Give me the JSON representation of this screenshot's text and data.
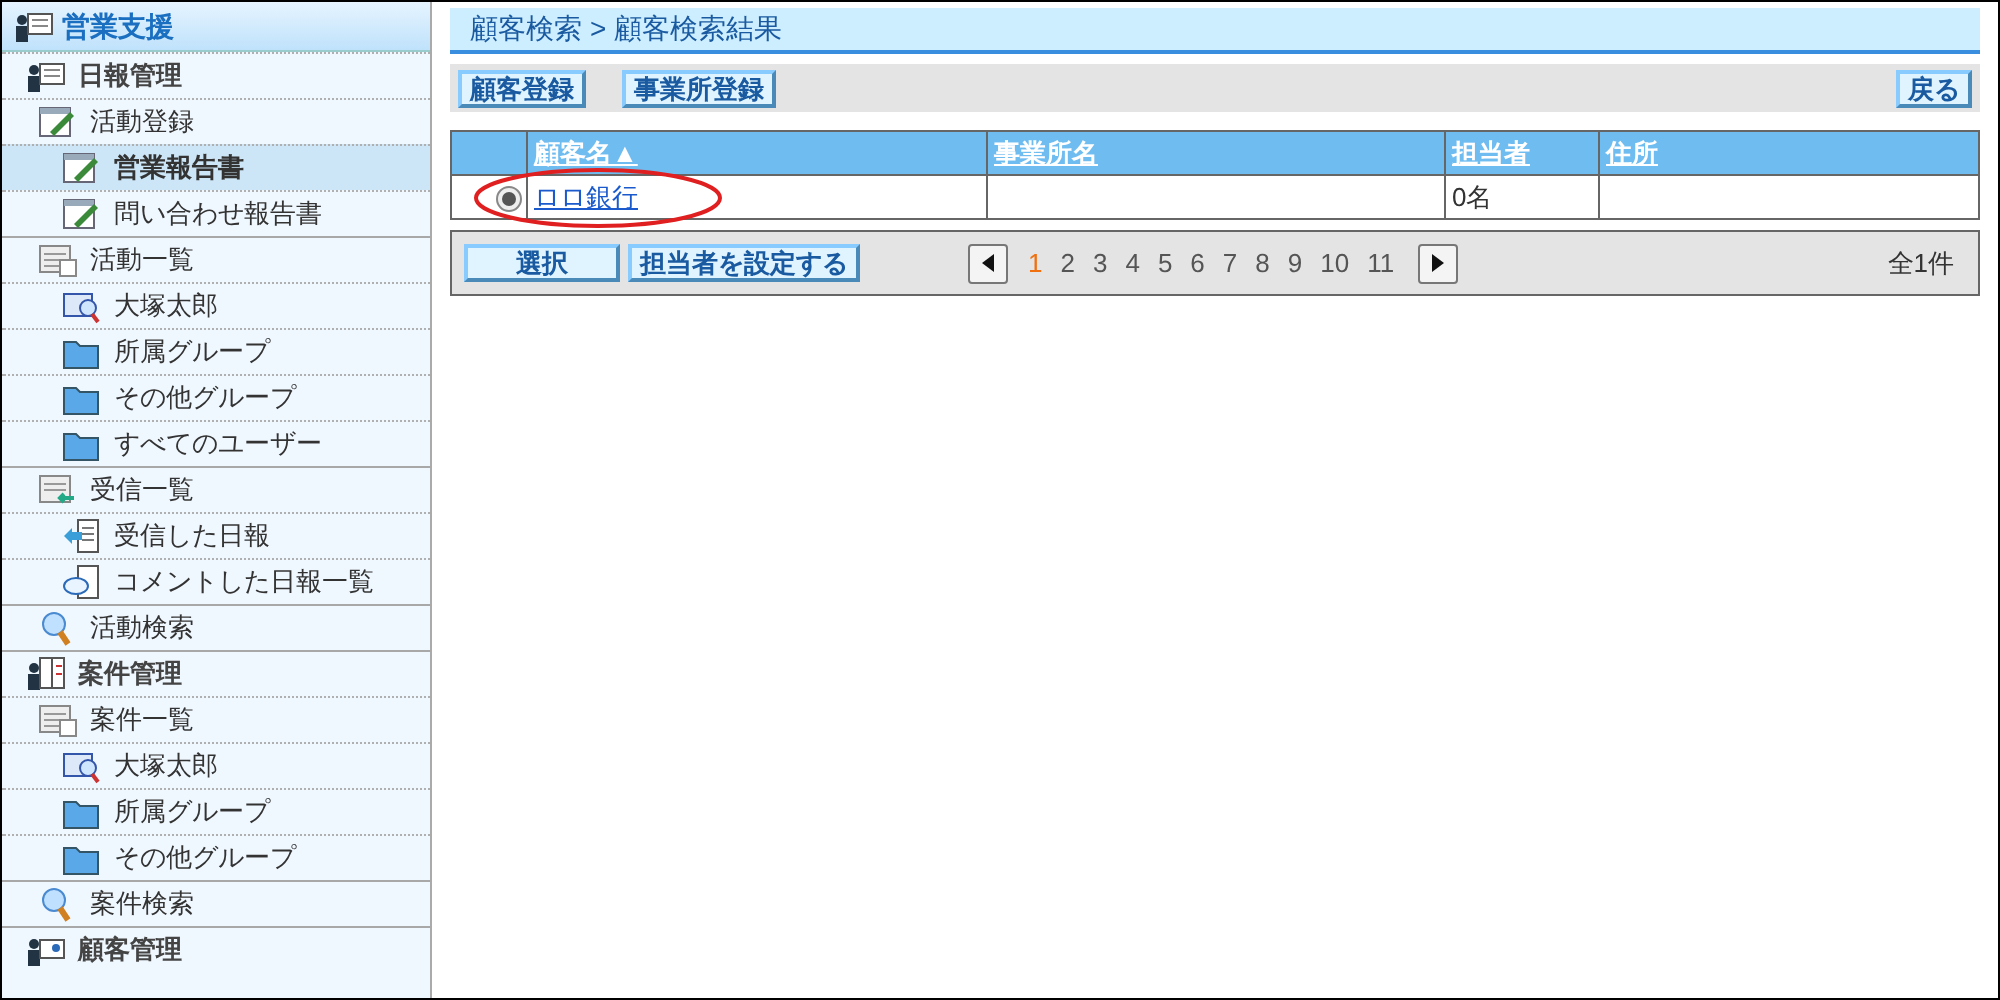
{
  "sidebar": {
    "title": "営業支援",
    "sections": [
      {
        "label": "日報管理",
        "kind": "report",
        "children": [
          {
            "label": "活動登録",
            "kind": "form",
            "selected": false,
            "children": [
              {
                "label": "営業報告書",
                "kind": "form",
                "selected": true
              },
              {
                "label": "問い合わせ報告書",
                "kind": "form",
                "selected": false
              }
            ]
          },
          {
            "label": "活動一覧",
            "kind": "list",
            "selected": false,
            "children": [
              {
                "label": "大塚太郎",
                "kind": "person",
                "selected": false
              },
              {
                "label": "所属グループ",
                "kind": "folder",
                "selected": false
              },
              {
                "label": "その他グループ",
                "kind": "folder",
                "selected": false
              },
              {
                "label": "すべてのユーザー",
                "kind": "folder",
                "selected": false
              }
            ]
          },
          {
            "label": "受信一覧",
            "kind": "inbox",
            "selected": false,
            "children": [
              {
                "label": "受信した日報",
                "kind": "received",
                "selected": false
              },
              {
                "label": "コメントした日報一覧",
                "kind": "comment",
                "selected": false
              }
            ]
          },
          {
            "label": "活動検索",
            "kind": "search",
            "selected": false
          }
        ]
      },
      {
        "label": "案件管理",
        "kind": "project",
        "children": [
          {
            "label": "案件一覧",
            "kind": "list",
            "selected": false,
            "children": [
              {
                "label": "大塚太郎",
                "kind": "person",
                "selected": false
              },
              {
                "label": "所属グループ",
                "kind": "folder",
                "selected": false
              },
              {
                "label": "その他グループ",
                "kind": "folder",
                "selected": false
              }
            ]
          },
          {
            "label": "案件検索",
            "kind": "search",
            "selected": false
          }
        ]
      },
      {
        "label": "顧客管理",
        "kind": "customer"
      }
    ]
  },
  "breadcrumb": [
    "顧客検索",
    "顧客検索結果"
  ],
  "breadcrumb_separator": ">",
  "toolbar": {
    "left_buttons": [
      "顧客登録",
      "事業所登録"
    ],
    "right_button": "戻る"
  },
  "table": {
    "columns": [
      "顧客名▲",
      "事業所名",
      "担当者",
      "住所"
    ],
    "rows": [
      {
        "selected": true,
        "cells": [
          "ロロ銀行",
          "",
          "0名",
          ""
        ],
        "highlighted": true
      }
    ]
  },
  "footer": {
    "buttons": [
      "選択",
      "担当者を設定する"
    ],
    "pages": [
      {
        "label": "1",
        "selected": true
      },
      {
        "label": "2",
        "selected": false
      },
      {
        "label": "3",
        "selected": false
      },
      {
        "label": "4",
        "selected": false
      },
      {
        "label": "5",
        "selected": false
      },
      {
        "label": "6",
        "selected": false
      },
      {
        "label": "7",
        "selected": false
      },
      {
        "label": "8",
        "selected": false
      },
      {
        "label": "9",
        "selected": false
      },
      {
        "label": "10",
        "selected": false
      },
      {
        "label": "11",
        "selected": false
      }
    ],
    "total": "全1件"
  }
}
